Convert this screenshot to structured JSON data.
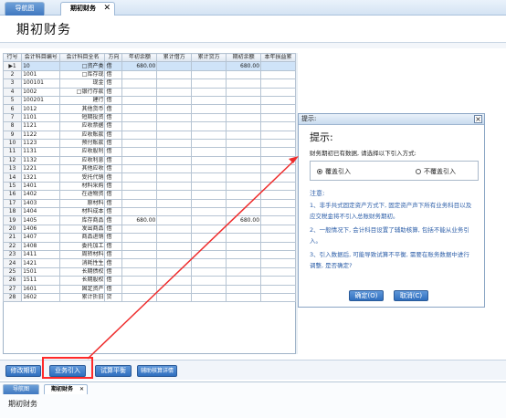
{
  "tabs": [
    {
      "label": "导航图"
    },
    {
      "label": "期初财务"
    }
  ],
  "page_title": "期初财务",
  "grid": {
    "headers": [
      "行号",
      "会计科目编号",
      "会计科目全名",
      "方向",
      "年初余额",
      "累计借方",
      "累计贷方",
      "期初余额",
      "本年损益累"
    ],
    "rows": [
      [
        "1",
        "10",
        "□资产类",
        "借",
        "680.00",
        "",
        "",
        "680.00",
        ""
      ],
      [
        "2",
        "1001",
        "□库存现",
        "借",
        "",
        "",
        "",
        "",
        ""
      ],
      [
        "3",
        "100101",
        "现金",
        "借",
        "",
        "",
        "",
        "",
        ""
      ],
      [
        "4",
        "1002",
        "□银行存款",
        "借",
        "",
        "",
        "",
        "",
        ""
      ],
      [
        "5",
        "100201",
        "建行",
        "借",
        "",
        "",
        "",
        "",
        ""
      ],
      [
        "6",
        "1012",
        "其他货币",
        "借",
        "",
        "",
        "",
        "",
        ""
      ],
      [
        "7",
        "1101",
        "短期投资",
        "借",
        "",
        "",
        "",
        "",
        ""
      ],
      [
        "8",
        "1121",
        "应收票据",
        "借",
        "",
        "",
        "",
        "",
        ""
      ],
      [
        "9",
        "1122",
        "应收账款",
        "借",
        "",
        "",
        "",
        "",
        ""
      ],
      [
        "10",
        "1123",
        "预付账款",
        "借",
        "",
        "",
        "",
        "",
        ""
      ],
      [
        "11",
        "1131",
        "应收股利",
        "借",
        "",
        "",
        "",
        "",
        ""
      ],
      [
        "12",
        "1132",
        "应收利息",
        "借",
        "",
        "",
        "",
        "",
        ""
      ],
      [
        "13",
        "1221",
        "其他应收",
        "借",
        "",
        "",
        "",
        "",
        ""
      ],
      [
        "14",
        "1321",
        "受托代销",
        "借",
        "",
        "",
        "",
        "",
        ""
      ],
      [
        "15",
        "1401",
        "材料采购",
        "借",
        "",
        "",
        "",
        "",
        ""
      ],
      [
        "16",
        "1402",
        "在途物资",
        "借",
        "",
        "",
        "",
        "",
        ""
      ],
      [
        "17",
        "1403",
        "原材料",
        "借",
        "",
        "",
        "",
        "",
        ""
      ],
      [
        "18",
        "1404",
        "材料成本",
        "借",
        "",
        "",
        "",
        "",
        ""
      ],
      [
        "19",
        "1405",
        "库存商品",
        "借",
        "680.00",
        "",
        "",
        "680.00",
        ""
      ],
      [
        "20",
        "1406",
        "发出商品",
        "借",
        "",
        "",
        "",
        "",
        ""
      ],
      [
        "21",
        "1407",
        "商品进销",
        "借",
        "",
        "",
        "",
        "",
        ""
      ],
      [
        "22",
        "1408",
        "委托加工",
        "借",
        "",
        "",
        "",
        "",
        ""
      ],
      [
        "23",
        "1411",
        "周转材料",
        "借",
        "",
        "",
        "",
        "",
        ""
      ],
      [
        "24",
        "1421",
        "消耗性生",
        "借",
        "",
        "",
        "",
        "",
        ""
      ],
      [
        "25",
        "1501",
        "长期债权",
        "借",
        "",
        "",
        "",
        "",
        ""
      ],
      [
        "26",
        "1511",
        "长期股权",
        "借",
        "",
        "",
        "",
        "",
        ""
      ],
      [
        "27",
        "1601",
        "固定资产",
        "借",
        "",
        "",
        "",
        "",
        ""
      ],
      [
        "28",
        "1602",
        "累计折旧",
        "贷",
        "",
        "",
        "",
        "",
        ""
      ]
    ]
  },
  "buttons": {
    "edit": "修改期初",
    "import": "业务引入",
    "trial": "试算平衡",
    "detail": "辅助核算详情"
  },
  "bottom_tabs": [
    {
      "label": "导航图"
    },
    {
      "label": "期初财务"
    }
  ],
  "bottom_title": "期初财务",
  "dialog": {
    "title": "提示:",
    "heading": "提示:",
    "prompt": "财务期初已有数据, 请选择以下引入方式:",
    "option_overwrite": "覆盖引入",
    "option_no_overwrite": "不覆盖引入",
    "note_title": "注意:",
    "note1": "1、非手共式固定资产方式下, 固定资产声下所有业务科目以及应交税金将不引入总账财务期初。",
    "note2": "2、一般情况下, 会计科目设置了辅助核算, 包括不能从业务引入。",
    "note3": "3、引入数据后, 可能导致试算不平衡, 需要在账务数据中进行调整, 是否确定?",
    "ok": "确定(O)",
    "cancel": "取消(C)"
  }
}
